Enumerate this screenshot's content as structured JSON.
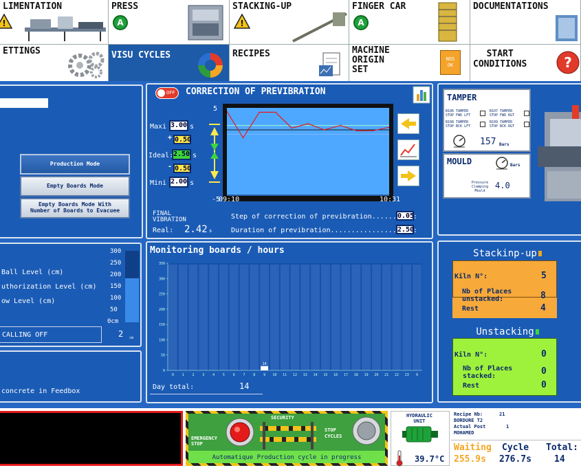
{
  "nav": {
    "row1": [
      {
        "label": "LIMENTATION",
        "status": "warning"
      },
      {
        "label": "PRESS",
        "status": "ok"
      },
      {
        "label": "STACKING-UP",
        "status": "warning"
      },
      {
        "label": "FINGER CAR",
        "status": "ok"
      },
      {
        "label": "DOCUMENTATIONS",
        "status": "none"
      }
    ],
    "row2": [
      {
        "label": "ETTINGS",
        "icon": "gears-icon"
      },
      {
        "label": "VISU CYCLES",
        "icon": "cycle-chart-icon"
      },
      {
        "label": "RECIPES",
        "icon": "recipe-document-icon"
      },
      {
        "label": "MACHINE\nORIGIN\nSET",
        "badge_line1": "NOS",
        "badge_line2": "OK"
      },
      {
        "label": "START\nCONDITIONS",
        "icon": "help-icon"
      }
    ]
  },
  "mode_panel": {
    "buttons": [
      "Production Mode",
      "Empty Boards Mode",
      "Empty Boards Mode With\nNumber of Boards to Evacuee"
    ]
  },
  "previbration": {
    "title": "CORRECTION OF PREVIBRATION",
    "toggle": "OFF",
    "maxi_label": "Maxi",
    "maxi_value": "3.00",
    "plus_value": "0.50",
    "ideal_label": "Ideal:",
    "ideal_value": "2.50",
    "minus_value": "0.50",
    "mini_label": "Mini",
    "mini_value": "2.00",
    "unit": "s",
    "y_top": "5",
    "y_bottom": "-5",
    "t_start": "09:10",
    "t_end": "10:31",
    "final_label": "FINAL\nVIBRATION",
    "real_label": "Real:",
    "real_value": "2.42",
    "real_unit": "s",
    "step_label": "Step of correction of previbration.......(s):",
    "step_value": "0.05",
    "duration_label": "Duration of previbration.................(s):",
    "duration_value": "2.50"
  },
  "level_panel": {
    "labels": [
      "Ball Level (cm)",
      "uthorization Level (cm)",
      "ow Level (cm)"
    ],
    "scale": [
      "300",
      "250",
      "200",
      "150",
      "100",
      "50",
      "0cm"
    ],
    "calling_label": "CALLING OFF",
    "calling_value": "2",
    "calling_unit": "cm",
    "fill_percent": 62
  },
  "concrete_panel": {
    "text": "concrete in Feedbox"
  },
  "monitoring": {
    "title": "Monitoring boards / hours",
    "day_total_label": "Day total:",
    "day_total_value": "14",
    "bar_label": "14"
  },
  "chart_data": [
    {
      "type": "line",
      "title": "CORRECTION OF PREVIBRATION",
      "x": [
        "09:10",
        "",
        "",
        "",
        "",
        "",
        "",
        "",
        "",
        "",
        "10:31"
      ],
      "series": [
        {
          "values": [
            4.6,
            1.6,
            4.5,
            4.5,
            2.7,
            3.2,
            2.5,
            3.0,
            2.4,
            2.4,
            2.8
          ]
        }
      ],
      "ylim": [
        -5,
        5
      ],
      "reference_lines": {
        "maxi": 3.0,
        "ideal": 2.5,
        "mini": 2.0
      }
    },
    {
      "type": "bar",
      "title": "Monitoring boards / hours",
      "categories": [
        "0",
        "1",
        "2",
        "3",
        "4",
        "5",
        "6",
        "7",
        "8",
        "9",
        "10",
        "11",
        "12",
        "13",
        "14",
        "15",
        "16",
        "17",
        "18",
        "19",
        "20",
        "21",
        "22",
        "23",
        "0"
      ],
      "values": [
        0,
        0,
        0,
        0,
        0,
        0,
        0,
        0,
        0,
        14,
        0,
        0,
        0,
        0,
        0,
        0,
        0,
        0,
        0,
        0,
        0,
        0,
        0,
        0,
        0
      ],
      "y_ticks": [
        "350",
        "300",
        "250",
        "200",
        "150",
        "100",
        "50",
        "0"
      ],
      "ylim": [
        0,
        350
      ]
    }
  ],
  "tamper": {
    "title": "TAMPER",
    "sensors": [
      "B106 TAMPER\nSTOP FWD LFT",
      "B107 TAMPER\nSTOP FWD RGT",
      "B108 TAMPER\nSTOP BCK LFT",
      "B109 TAMPER\nSTOP BCK RGT"
    ],
    "pressure_value": "157",
    "pressure_unit": "Bars"
  },
  "mould": {
    "title": "MOULD",
    "unit": "Bars",
    "clamp_label": "Pressure\nClamping\nMould",
    "clamp_value": "4.0"
  },
  "stacking": {
    "title": "Stackinp-up",
    "kiln_label": "Kiln N°:",
    "kiln_value": "5",
    "places_label": "Nb of Places\nunstacked:",
    "places_value": "8",
    "rest_label": "Rest",
    "rest_value": "4"
  },
  "unstacking": {
    "title": "Unstacking",
    "kiln_label": "Kiln N°:",
    "kiln_value": "0",
    "places_label": "Nb of Places\nstacked:",
    "places_value": "0",
    "rest_label": "Rest",
    "rest_value": "0"
  },
  "security": {
    "emergency": "EMERGENCY\nSTOP",
    "security": "SECURITY",
    "stop_cycles": "STOP\nCYCLES",
    "status": "Automatique Production cycle in progress"
  },
  "hydraulic": {
    "title": "HYDRAULIC\nUNIT",
    "temp": "39.7°C"
  },
  "recipe": {
    "recipe_label": "Recipe Nb:",
    "recipe_value": "21",
    "name": "BORDURE T2",
    "actual_label": "Actual Post",
    "actual_value": "1",
    "operator": "MOHAMED"
  },
  "cycle": {
    "waiting_label": "Waiting",
    "waiting_value": "255.9s",
    "cycle_label": "Cycle",
    "cycle_value": "276.7s",
    "total_label": "Total:",
    "total_value": "14"
  }
}
